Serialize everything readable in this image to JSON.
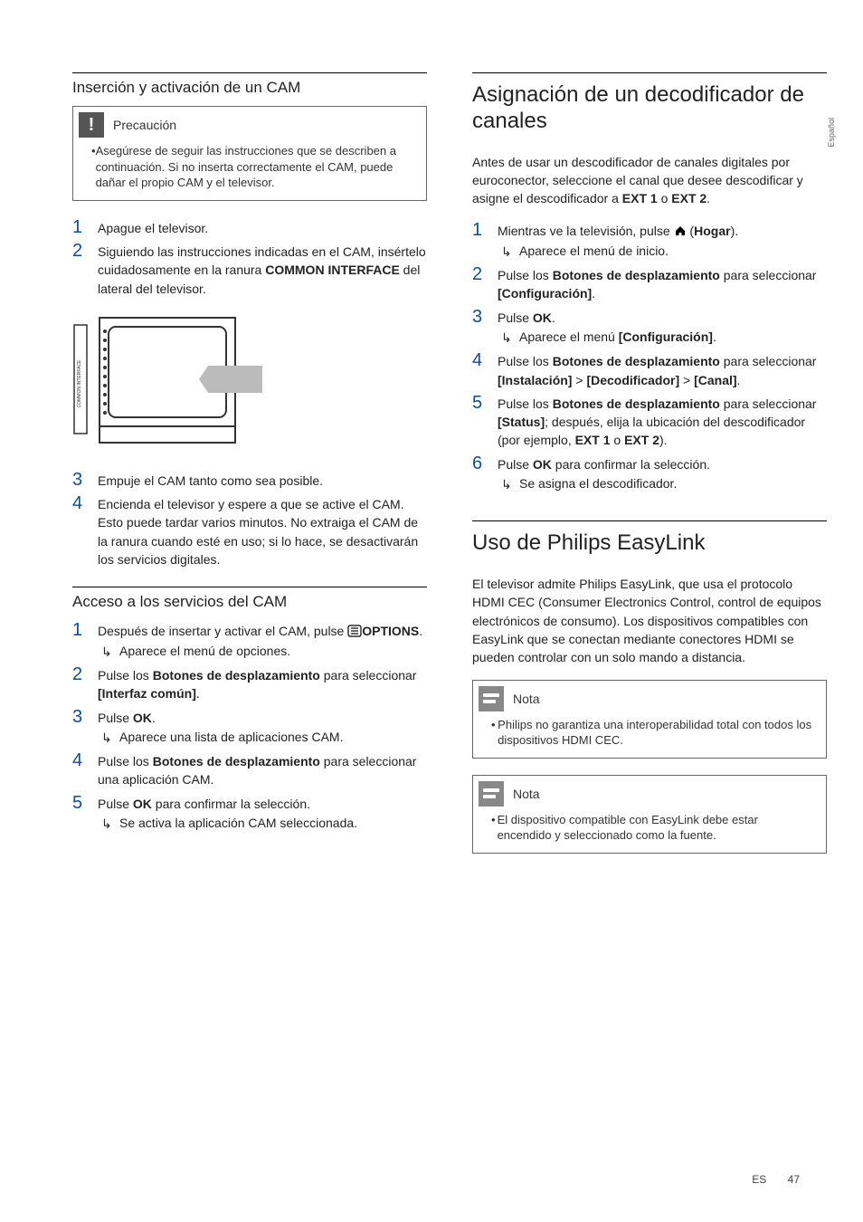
{
  "side_tab": "Español",
  "left": {
    "h1": "Inserción y activación de un CAM",
    "caution_label": "Precaución",
    "caution_body": "Asegúrese de seguir las instrucciones que se describen a continuación. Si no inserta correctamente el CAM, puede dañar el propio CAM y el televisor.",
    "steps_a": [
      "Apague el televisor.",
      {
        "pre": "Siguiendo las instrucciones indicadas en el CAM, insértelo cuidadosamente en la ranura ",
        "bold": "COMMON INTERFACE",
        "post": " del lateral del televisor."
      }
    ],
    "steps_b": [
      "Empuje el CAM tanto como sea posible.",
      "Encienda el televisor y espere a que se active el CAM. Esto puede tardar varios minutos. No extraiga el CAM de la ranura cuando esté en uso; si lo hace, se desactivarán los servicios digitales."
    ],
    "h2": "Acceso a los servicios del CAM",
    "steps_c": [
      {
        "num": "1",
        "parts": [
          {
            "t": "Después de insertar y activar el CAM, pulse "
          },
          {
            "icon": "options"
          },
          {
            "t": " ",
            "b": "OPTIONS"
          },
          {
            "t": "."
          }
        ],
        "sub": "Aparece el menú de opciones."
      },
      {
        "num": "2",
        "parts": [
          {
            "t": "Pulse los "
          },
          {
            "b": "Botones de desplazamiento"
          },
          {
            "t": " para seleccionar "
          },
          {
            "b": "[Interfaz común]"
          },
          {
            "t": "."
          }
        ]
      },
      {
        "num": "3",
        "parts": [
          {
            "t": "Pulse "
          },
          {
            "b": "OK"
          },
          {
            "t": "."
          }
        ],
        "sub": "Aparece una lista de aplicaciones CAM."
      },
      {
        "num": "4",
        "parts": [
          {
            "t": "Pulse los "
          },
          {
            "b": "Botones de desplazamiento"
          },
          {
            "t": " para seleccionar una aplicación CAM."
          }
        ]
      },
      {
        "num": "5",
        "parts": [
          {
            "t": "Pulse "
          },
          {
            "b": "OK"
          },
          {
            "t": " para confirmar la selección."
          }
        ],
        "sub": "Se activa la aplicación CAM seleccionada."
      }
    ]
  },
  "right": {
    "h1": "Asignación de un decodificador de canales",
    "intro_parts": [
      {
        "t": "Antes de usar un descodificador de canales digitales por euroconector, seleccione el canal que desee descodificar y asigne el descodificador a "
      },
      {
        "b": "EXT 1"
      },
      {
        "t": " o "
      },
      {
        "b": "EXT 2"
      },
      {
        "t": "."
      }
    ],
    "steps": [
      {
        "num": "1",
        "parts": [
          {
            "t": "Mientras ve la televisión, pulse "
          },
          {
            "icon": "home"
          },
          {
            "t": " ("
          },
          {
            "b": "Hogar"
          },
          {
            "t": ")."
          }
        ],
        "sub": "Aparece el menú de inicio."
      },
      {
        "num": "2",
        "parts": [
          {
            "t": "Pulse los "
          },
          {
            "b": "Botones de desplazamiento"
          },
          {
            "t": " para seleccionar "
          },
          {
            "b": "[Configuración]"
          },
          {
            "t": "."
          }
        ]
      },
      {
        "num": "3",
        "parts": [
          {
            "t": "Pulse "
          },
          {
            "b": "OK"
          },
          {
            "t": "."
          }
        ],
        "sub_parts": [
          {
            "t": "Aparece el menú "
          },
          {
            "b": "[Configuración]"
          },
          {
            "t": "."
          }
        ]
      },
      {
        "num": "4",
        "parts": [
          {
            "t": "Pulse los "
          },
          {
            "b": "Botones de desplazamiento"
          },
          {
            "t": " para seleccionar "
          },
          {
            "b": "[Instalación]"
          },
          {
            "t": " > "
          },
          {
            "b": "[Decodificador]"
          },
          {
            "t": " > "
          },
          {
            "b": "[Canal]"
          },
          {
            "t": "."
          }
        ]
      },
      {
        "num": "5",
        "parts": [
          {
            "t": "Pulse los "
          },
          {
            "b": "Botones de desplazamiento"
          },
          {
            "t": " para seleccionar "
          },
          {
            "b": "[Status]"
          },
          {
            "t": "; después, elija la ubicación del descodificador (por ejemplo, "
          },
          {
            "b": "EXT 1"
          },
          {
            "t": " o "
          },
          {
            "b": "EXT 2"
          },
          {
            "t": ")."
          }
        ]
      },
      {
        "num": "6",
        "parts": [
          {
            "t": "Pulse "
          },
          {
            "b": "OK"
          },
          {
            "t": " para confirmar la selección."
          }
        ],
        "sub": "Se asigna el descodificador."
      }
    ],
    "h2": "Uso de Philips EasyLink",
    "para2": "El televisor admite Philips EasyLink, que usa el protocolo HDMI CEC (Consumer Electronics Control, control de equipos electrónicos de consumo). Los dispositivos compatibles con EasyLink que se conectan mediante conectores HDMI se pueden controlar con un solo mando a distancia.",
    "note_label": "Nota",
    "note1": "Philips no garantiza una interoperabilidad total con todos los dispositivos HDMI CEC.",
    "note2": "El dispositivo compatible con EasyLink debe estar encendido y seleccionado como la fuente."
  },
  "footer": {
    "lang": "ES",
    "page": "47"
  },
  "figure_label": "COMMON INTERFACE"
}
